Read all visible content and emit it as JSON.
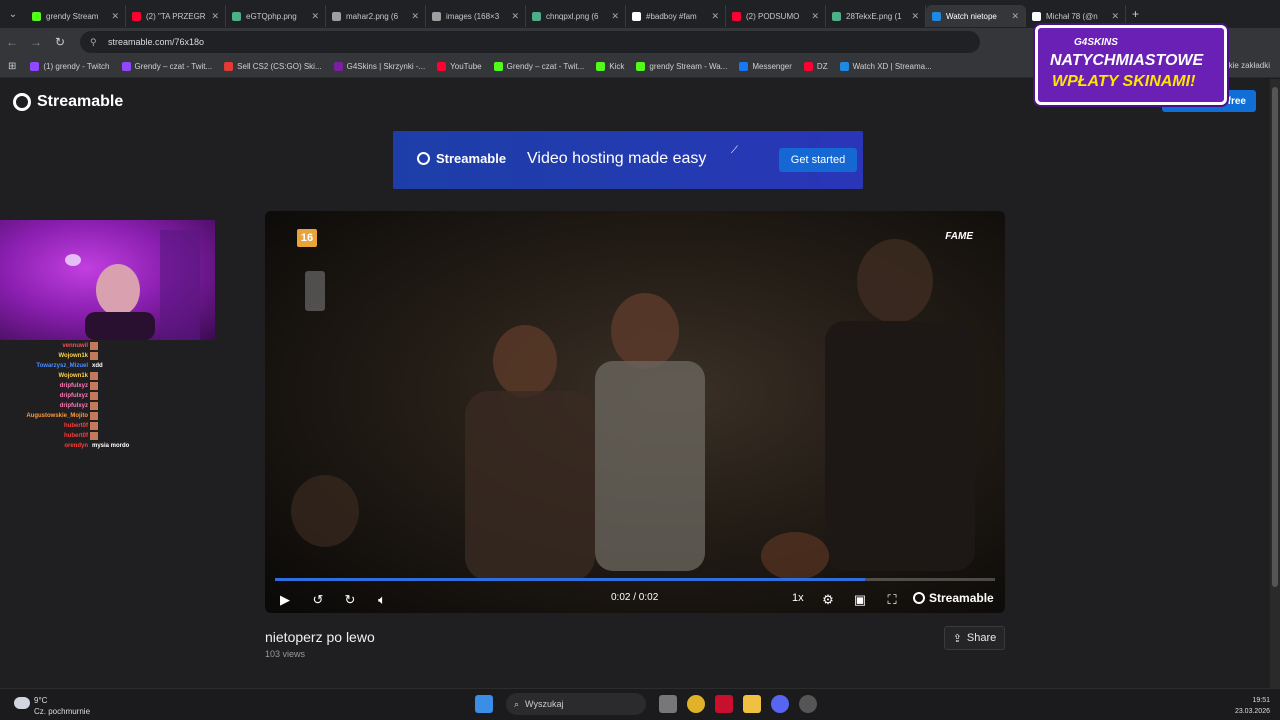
{
  "browser": {
    "tabs": [
      {
        "label": "grendy Stream",
        "color": "#53fc18"
      },
      {
        "label": "(2) \"TA PRZEGR",
        "color": "#ff0033"
      },
      {
        "label": "eGTQphp.png",
        "color": "#4caf88"
      },
      {
        "label": "mahar2.png (6",
        "color": "#9e9e9e"
      },
      {
        "label": "images (168×3",
        "color": "#9e9e9e"
      },
      {
        "label": "chnqpxl.png (6",
        "color": "#4caf88"
      },
      {
        "label": "#badboy #fam",
        "color": "#ffffff"
      },
      {
        "label": "(2) PODSUMO",
        "color": "#ff0033"
      },
      {
        "label": "28TekxE.png (1",
        "color": "#4caf88"
      },
      {
        "label": "Watch nietope",
        "color": "#1e88e5"
      },
      {
        "label": "Michał 78 (@n",
        "color": "#ffffff"
      }
    ],
    "url": "streamable.com/76x18o",
    "bookmarks": [
      {
        "label": "(1) grendy - Twitch",
        "color": "#9146ff"
      },
      {
        "label": "Grendy – czat - Twit...",
        "color": "#9146ff"
      },
      {
        "label": "Sell CS2 (CS:GO) Ski...",
        "color": "#e53935"
      },
      {
        "label": "G4Skins | Skrzynki -...",
        "color": "#7b1fa2"
      },
      {
        "label": "YouTube",
        "color": "#ff0033"
      },
      {
        "label": "Grendy – czat - Twit...",
        "color": "#53fc18"
      },
      {
        "label": "Kick",
        "color": "#53fc18"
      },
      {
        "label": "grendy Stream - Wa...",
        "color": "#53fc18"
      },
      {
        "label": "Messenger",
        "color": "#1877f2"
      },
      {
        "label": "DZ",
        "color": "#ff0033"
      },
      {
        "label": "Watch XD | Streama...",
        "color": "#1e88e5"
      }
    ],
    "bookmarks_right": "tkie zakładki"
  },
  "site": {
    "logo": "Streamable",
    "signup_label": "n free",
    "banner": {
      "logo": "Streamable",
      "tagline": "Video hosting made easy",
      "cta": "Get started"
    },
    "video": {
      "age_badge": "16",
      "channel_mark": "FAME",
      "time": "0:02 / 0:02",
      "speed": "1x",
      "progress": 0.82,
      "brand": "Streamable"
    },
    "title": "nietoperz po lewo",
    "views": "103 views",
    "share_label": "Share"
  },
  "stream_overlay": {
    "chat": [
      {
        "name": "vennuwil",
        "msg": "",
        "color": "#ff4d4d"
      },
      {
        "name": "Wojown1k",
        "msg": "",
        "color": "#ffd24d"
      },
      {
        "name": "Towarzysz_Mizuel",
        "msg": "xdd",
        "color": "#4d8cff"
      },
      {
        "name": "Wojown1k",
        "msg": "",
        "color": "#ffd24d"
      },
      {
        "name": "dripfulxyz",
        "msg": "",
        "color": "#ff7ab8"
      },
      {
        "name": "dripfulxyz",
        "msg": "",
        "color": "#ff7ab8"
      },
      {
        "name": "dripfulxyz",
        "msg": "",
        "color": "#ff7ab8"
      },
      {
        "name": "Augustowskie_Mojito",
        "msg": "",
        "color": "#ff9a3d"
      },
      {
        "name": "hubert0f",
        "msg": "",
        "color": "#ff3d3d"
      },
      {
        "name": "hubert0f",
        "msg": "",
        "color": "#ff3d3d"
      },
      {
        "name": "orendyn",
        "msg": "mysia mordo",
        "color": "#ff3d3d"
      }
    ],
    "ad": {
      "brand": "G4SKINS",
      "line1": "NATYCHMIASTOWE",
      "line2": "WPŁATY SKINAMI!"
    }
  },
  "taskbar": {
    "temp": "9°C",
    "weather": "Cz. pochmurnie",
    "search_placeholder": "Wyszukaj",
    "time": "19:51",
    "date": "23.03.2026"
  }
}
